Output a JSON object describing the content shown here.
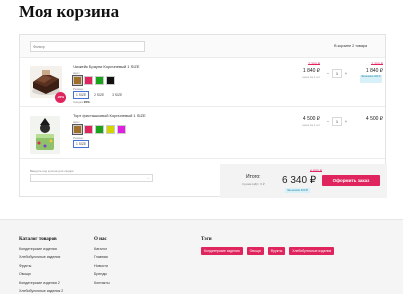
{
  "page": {
    "title": "Моя корзина"
  },
  "cart": {
    "filter_placeholder": "Фильтр",
    "count_label": "В корзине 2 товара",
    "items": [
      {
        "name": "Чизкейк Брауни Коричневый 1 SIZE",
        "image": "brownie-cheesecake-image",
        "sale_badge": "-20%",
        "color_label": "Цвет",
        "colors": [
          "#a0702a",
          "#e0245e",
          "#1aa31a",
          "#111111"
        ],
        "size_label": "Размер",
        "sizes": [
          "1 SIZE",
          "2 SIZE",
          "3 SIZE"
        ],
        "selected_size": 0,
        "discount_label": "Скидка",
        "discount_value": "20%",
        "old_price": "2 300 ₽",
        "unit_price": "1 840 ₽",
        "unit_note": "цена за 1 шт",
        "qty": "1",
        "line_total": "1 840 ₽",
        "line_old": "2 300 ₽",
        "save_text": "Экономия 460 ₽"
      },
      {
        "name": "Торт фисташковый Коричневый 1 SIZE",
        "image": "pistachio-cake-image",
        "color_label": "Цвет",
        "colors": [
          "#a0702a",
          "#e0245e",
          "#1aa31a",
          "#d4d400",
          "#e020e0"
        ],
        "size_label": "Размер",
        "sizes": [
          "1 SIZE"
        ],
        "selected_size": 0,
        "unit_price": "4 500 ₽",
        "unit_note": "цена за 1 шт",
        "qty": "1",
        "line_total": "4 500 ₽"
      }
    ],
    "coupon_label": "Введите код купона для скидки",
    "total_label": "Итого:",
    "total_vat": "Сумма НДС: 0 ₽",
    "total_sum": "6 340 ₽",
    "total_old": "6 800 ₽",
    "total_save": "Экономия 460 ₽",
    "checkout_label": "Оформить заказ",
    "minus": "−",
    "plus": "+"
  },
  "footer": {
    "catalog": {
      "title": "Каталог товаров",
      "links": [
        "Кондитерские изделия",
        "Хлебобулочные изделия",
        "Фрукты",
        "Овощи",
        "Кондитерские изделия 2",
        "Хлебобулочные изделия 2"
      ]
    },
    "about": {
      "title": "О нас",
      "links": [
        "Каталог",
        "Главная",
        "Новости",
        "Бренды",
        "Контакты"
      ]
    },
    "tags": {
      "title": "Тэги",
      "items": [
        "Кондитерские изделия",
        "Овощи",
        "Фрукты",
        "Хлебобулочные изделия"
      ]
    }
  }
}
